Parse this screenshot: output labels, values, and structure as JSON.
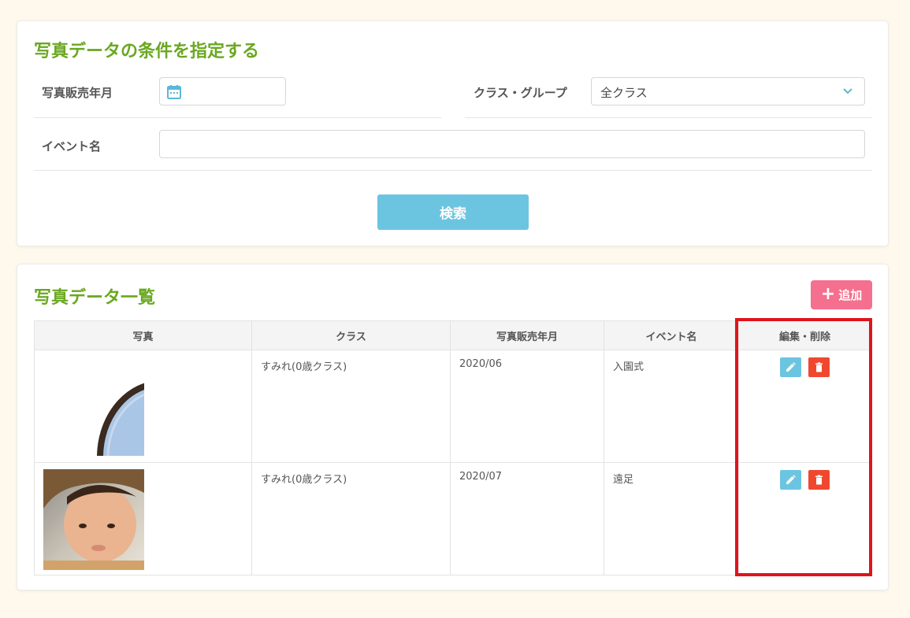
{
  "search_panel": {
    "title": "写真データの条件を指定する",
    "sale_month_label": "写真販売年月",
    "sale_month_value": "",
    "class_label": "クラス・グループ",
    "class_selected": "全クラス",
    "event_label": "イベント名",
    "event_value": "",
    "search_button": "検索"
  },
  "list_panel": {
    "title": "写真データ一覧",
    "add_button": "追加",
    "columns": [
      "写真",
      "クラス",
      "写真販売年月",
      "イベント名",
      "編集・削除"
    ],
    "rows": [
      {
        "class": "すみれ(0歳クラス)",
        "month": "2020/06",
        "event": "入園式"
      },
      {
        "class": "すみれ(0歳クラス)",
        "month": "2020/07",
        "event": "遠足"
      }
    ]
  },
  "colors": {
    "title_green": "#6aa821",
    "search_blue": "#6cc5e0",
    "add_pink": "#f56f8e",
    "delete_red": "#f0482f",
    "highlight_red": "#e0131c",
    "page_bg": "#fef9ec"
  },
  "icons": [
    "calendar-icon",
    "chevron-down-icon",
    "plus-icon",
    "pencil-icon",
    "trash-icon"
  ]
}
